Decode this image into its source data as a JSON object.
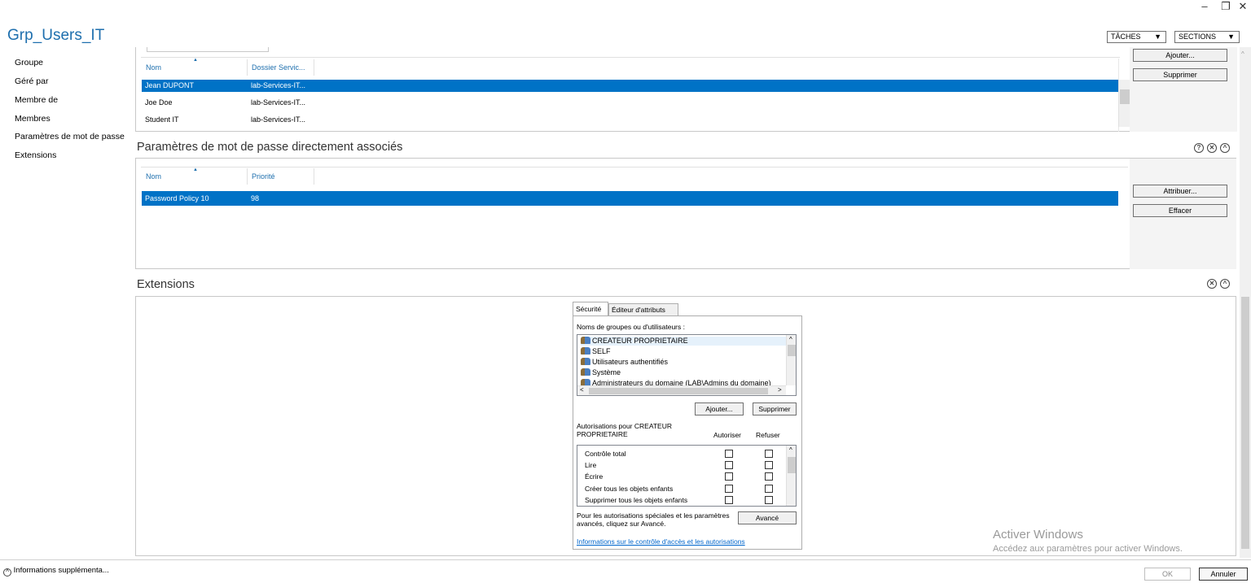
{
  "window": {
    "minimize": "–",
    "restore": "❐",
    "close": "✕"
  },
  "title": "Grp_Users_IT",
  "top_buttons": {
    "tasks": "TÂCHES",
    "sections": "SECTIONS",
    "dropdown_glyph": "▼"
  },
  "nav": [
    "Groupe",
    "Géré par",
    "Membre de",
    "Membres",
    "Paramètres de mot de passe",
    "Extensions"
  ],
  "members": {
    "columns": [
      "Nom",
      "Dossier Servic..."
    ],
    "rows": [
      {
        "name": "Jean DUPONT",
        "folder": "lab-Services-IT..."
      },
      {
        "name": "Joe Doe",
        "folder": "lab-Services-IT..."
      },
      {
        "name": "Student IT",
        "folder": "lab-Services-IT..."
      }
    ],
    "add": "Ajouter...",
    "remove": "Supprimer"
  },
  "password": {
    "title": "Paramètres de mot de passe directement associés",
    "columns": [
      "Nom",
      "Priorité"
    ],
    "rows": [
      {
        "name": "Password Policy 10",
        "priority": "98"
      }
    ],
    "assign": "Attribuer...",
    "clear": "Effacer"
  },
  "extensions": {
    "title": "Extensions",
    "tabs": [
      "Sécurité",
      "Éditeur d'attributs"
    ],
    "groups_label": "Noms de groupes ou d'utilisateurs :",
    "users": [
      "CREATEUR PROPRIETAIRE",
      "SELF",
      "Utilisateurs authentifiés",
      "Système",
      "Administrateurs du domaine (LAB\\Admins du domaine)"
    ],
    "add": "Ajouter...",
    "remove": "Supprimer",
    "perms_for": "Autorisations pour CREATEUR PROPRIETAIRE",
    "allow": "Autoriser",
    "deny": "Refuser",
    "permissions": [
      "Contrôle total",
      "Lire",
      "Écrire",
      "Créer tous les objets enfants",
      "Supprimer tous les objets enfants"
    ],
    "advanced_text": "Pour les autorisations spéciales et les paramètres avancés, cliquez sur Avancé.",
    "advanced": "Avancé",
    "info_link": "Informations sur le contrôle d'accès et les autorisations"
  },
  "watermark": {
    "line1": "Activer Windows",
    "line2": "Accédez aux paramètres pour activer Windows."
  },
  "footer": {
    "more_info": "Informations supplémenta...",
    "ok": "OK",
    "cancel": "Annuler"
  },
  "colors": {
    "accent": "#1e6fae",
    "selection": "#0072c6"
  }
}
